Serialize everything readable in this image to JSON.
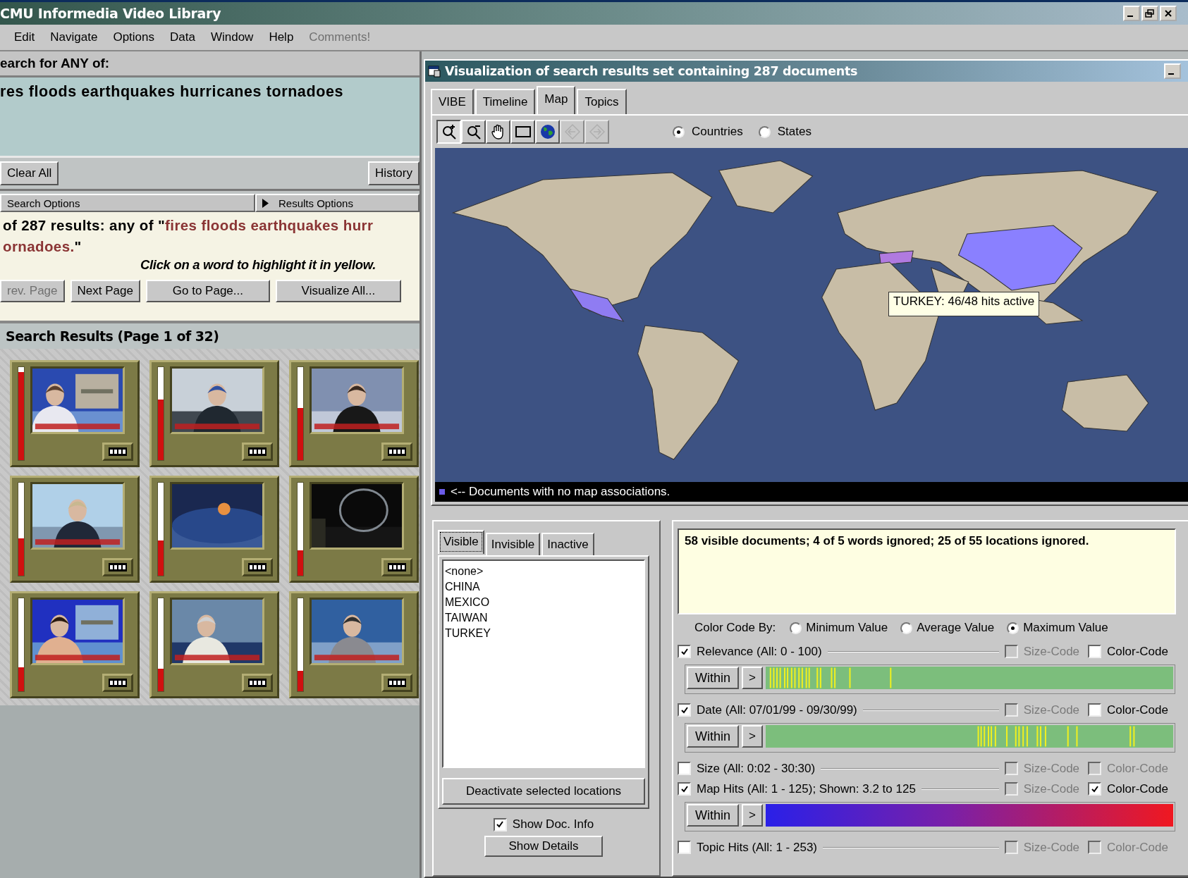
{
  "main_window": {
    "title": "CMU Informedia Video Library"
  },
  "menu": [
    {
      "label": "Edit",
      "disabled": false
    },
    {
      "label": "Navigate",
      "disabled": false
    },
    {
      "label": "Options",
      "disabled": false
    },
    {
      "label": "Data",
      "disabled": false
    },
    {
      "label": "Window",
      "disabled": false
    },
    {
      "label": "Help",
      "disabled": false
    },
    {
      "label": "Comments!",
      "disabled": true
    }
  ],
  "search": {
    "label": "earch for ANY of:",
    "value": "res floods earthquakes hurricanes tornadoes",
    "buttons": [
      "Clear All",
      "History"
    ]
  },
  "option_bars": [
    {
      "label": "Search Options",
      "arrow": false
    },
    {
      "label": "Results Options",
      "arrow": true
    }
  ],
  "results": {
    "summary_lines": [
      [
        {
          "kind": "plain",
          "text": "of 287 results: any of \""
        },
        {
          "kind": "query",
          "text": "fires floods earthquakes hurr"
        }
      ],
      [
        {
          "kind": "query",
          "text": "ornadoes."
        },
        {
          "kind": "plain",
          "text": "\""
        }
      ]
    ],
    "hint": "Click on a word to highlight it in yellow.",
    "paging": [
      {
        "label": "rev. Page",
        "disabled": true
      },
      {
        "label": "Next Page",
        "disabled": false
      },
      {
        "label": "Go to Page...",
        "disabled": false
      },
      {
        "label": "Visualize All...",
        "disabled": false
      }
    ],
    "header": "Search Results (Page 1 of 32)",
    "thumbnails": [
      {
        "level": 0.95
      },
      {
        "level": 0.65
      },
      {
        "level": 0.56
      },
      {
        "level": 0.4
      },
      {
        "level": 0.38
      },
      {
        "level": 0.27
      },
      {
        "level": 0.26
      },
      {
        "level": 0.24
      },
      {
        "level": 0.22
      }
    ]
  },
  "viz": {
    "title": "Visualization of search results set containing 287 documents",
    "tabs": [
      {
        "label": "VIBE",
        "selected": false
      },
      {
        "label": "Timeline",
        "selected": false
      },
      {
        "label": "Map",
        "selected": true
      },
      {
        "label": "Topics",
        "selected": false
      }
    ],
    "tools": [
      {
        "kind": "zoom-in",
        "selected": true,
        "disabled": false
      },
      {
        "kind": "zoom-out",
        "selected": false,
        "disabled": false
      },
      {
        "kind": "pan",
        "selected": false,
        "disabled": false
      },
      {
        "kind": "select",
        "selected": false,
        "disabled": false
      },
      {
        "kind": "globe",
        "selected": false,
        "disabled": false
      },
      {
        "kind": "back",
        "selected": false,
        "disabled": true
      },
      {
        "kind": "forward",
        "selected": false,
        "disabled": true
      }
    ],
    "map_level": [
      {
        "label": "Countries",
        "selected": true
      },
      {
        "label": "States",
        "selected": false
      }
    ],
    "tooltip": "TURKEY: 46/48 hits active",
    "status": "<-- Documents with no map associations.",
    "location_tabs": [
      {
        "label": "Visible",
        "selected": true
      },
      {
        "label": "Invisible",
        "selected": false
      },
      {
        "label": "Inactive",
        "selected": false
      }
    ],
    "locations": [
      "<none>",
      "CHINA",
      "MEXICO",
      "TAIWAN",
      "TURKEY"
    ],
    "deactivate_button": "Deactivate selected locations",
    "show_doc_info": {
      "label": "Show Doc. Info",
      "checked": true
    },
    "details_button": "Show Details",
    "info_text": "58 visible documents; 4 of 5 words ignored; 25 of 55 locations ignored.",
    "color_code": {
      "label": "Color Code By:",
      "options": [
        {
          "label": "Minimum Value",
          "selected": false
        },
        {
          "label": "Average Value",
          "selected": false
        },
        {
          "label": "Maximum Value",
          "selected": true
        }
      ]
    },
    "attributes": [
      {
        "label": "Relevance  (All: 0 - 100)",
        "checked": true,
        "size_code": {
          "label": "Size-Code",
          "checked": false,
          "disabled": true
        },
        "color_code": {
          "label": "Color-Code",
          "checked": false,
          "disabled": false
        },
        "bar": {
          "kind": "relevance-ticks",
          "button": "Within",
          "step": ">"
        }
      },
      {
        "label": "Date  (All: 07/01/99 - 09/30/99)",
        "checked": true,
        "size_code": {
          "label": "Size-Code",
          "checked": false,
          "disabled": true
        },
        "color_code": {
          "label": "Color-Code",
          "checked": false,
          "disabled": false
        },
        "bar": {
          "kind": "date-ticks",
          "button": "Within",
          "step": ">"
        }
      },
      {
        "label": "Size  (All: 0:02 - 30:30)",
        "checked": false,
        "size_code": {
          "label": "Size-Code",
          "checked": false,
          "disabled": true
        },
        "color_code": {
          "label": "Color-Code",
          "checked": false,
          "disabled": true
        }
      },
      {
        "label": "Map Hits (All: 1 - 125); Shown: 3.2 to 125",
        "checked": true,
        "size_code": {
          "label": "Size-Code",
          "checked": false,
          "disabled": true
        },
        "color_code": {
          "label": "Color-Code",
          "checked": true,
          "disabled": false
        },
        "bar": {
          "kind": "gradient",
          "button": "Within",
          "step": ">"
        }
      },
      {
        "label": "Topic Hits (All: 1 - 253)",
        "checked": false,
        "size_code": {
          "label": "Size-Code",
          "checked": false,
          "disabled": true
        },
        "color_code": {
          "label": "Color-Code",
          "checked": false,
          "disabled": true
        }
      }
    ]
  }
}
